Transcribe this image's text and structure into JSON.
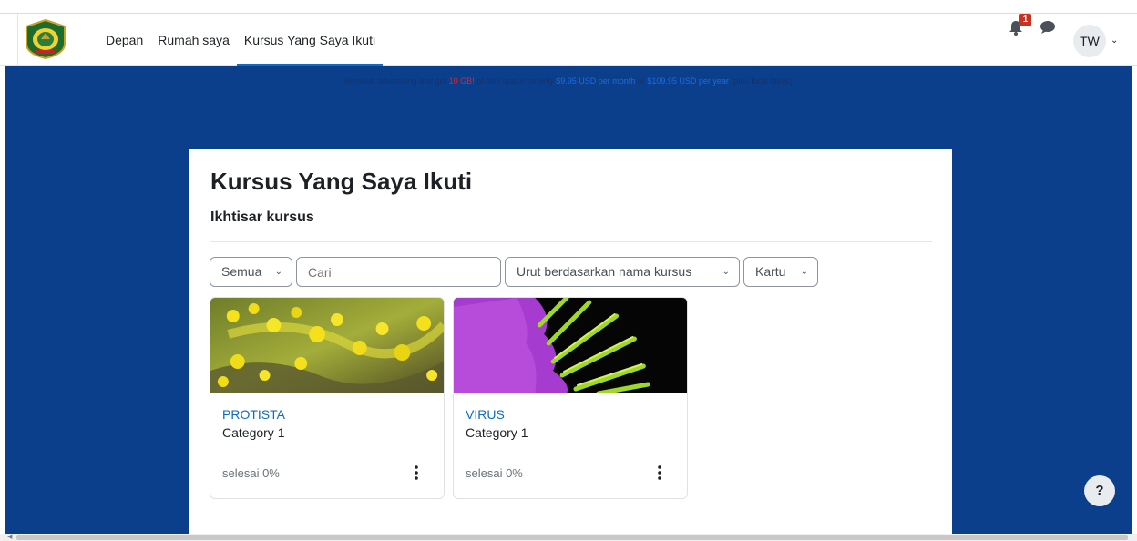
{
  "nav": {
    "links": [
      {
        "label": "Depan"
      },
      {
        "label": "Rumah saya"
      },
      {
        "label": "Kursus Yang Saya Ikuti"
      }
    ],
    "notification_count": "1",
    "user_initials": "TW"
  },
  "promo": {
    "p1": "Remove advertising and get ",
    "p2": "10 GB",
    "p3": "!",
    "p4": " of disk space for only ",
    "p5": "$9.95 USD per month",
    "p6": " or ",
    "p7": "$109.95 USD per year",
    "p8": " (plus local taxes)"
  },
  "page": {
    "title": "Kursus Yang Saya Ikuti",
    "section": "Ikhtisar kursus"
  },
  "filters": {
    "grouping": "Semua",
    "search_placeholder": "Cari",
    "sort": "Urut berdasarkan nama kursus",
    "view": "Kartu"
  },
  "courses": [
    {
      "name": "PROTISTA",
      "category": "Category 1",
      "progress": "selesai 0%"
    },
    {
      "name": "VIRUS",
      "category": "Category 1",
      "progress": "selesai 0%"
    }
  ],
  "help": {
    "label": "?"
  },
  "colors": {
    "accent": "#0f6cbf",
    "banner": "#0b3f8c",
    "badge": "#ca3120"
  }
}
